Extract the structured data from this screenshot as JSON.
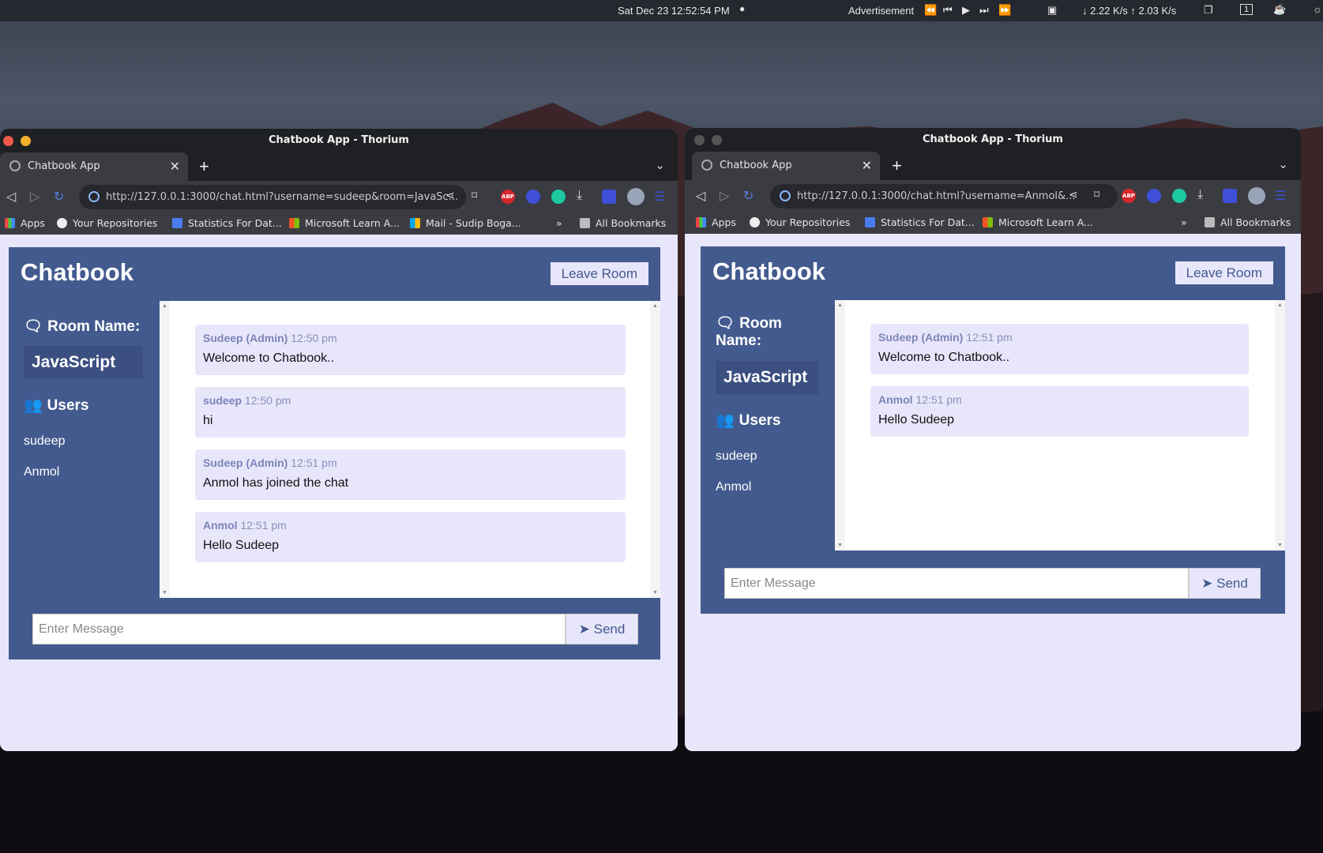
{
  "topbar": {
    "datetime": "Sat Dec 23  12:52:54 PM",
    "advertisement": "Advertisement",
    "netspeed": "↓ 2.22 K/s ↑ 2.03 K/s",
    "workspace": "1"
  },
  "left_window": {
    "title": "Chatbook App - Thorium",
    "tab_label": "Chatbook App",
    "url": "http://127.0.0.1:3000/chat.html?username=sudeep&room=JavaSc...",
    "bookmarks": [
      "Apps",
      "Your Repositories",
      "Statistics For Dat...",
      "Microsoft Learn A...",
      "Mail - Sudip Boga..."
    ],
    "more_bookmarks": "»",
    "all_bookmarks": "All Bookmarks",
    "app": {
      "title": "Chatbook",
      "leave_label": "Leave Room",
      "room_heading": "Room Name:",
      "room_name": "JavaScript",
      "users_heading": "Users",
      "users": [
        "sudeep",
        "Anmol"
      ],
      "messages": [
        {
          "author": "Sudeep (Admin)",
          "time": "12:50 pm",
          "text": "Welcome to Chatbook.."
        },
        {
          "author": "sudeep",
          "time": "12:50 pm",
          "text": "hi"
        },
        {
          "author": "Sudeep (Admin)",
          "time": "12:51 pm",
          "text": "Anmol has joined the chat"
        },
        {
          "author": "Anmol",
          "time": "12:51 pm",
          "text": "Hello Sudeep"
        }
      ],
      "input_placeholder": "Enter Message",
      "send_label": "Send"
    }
  },
  "right_window": {
    "title": "Chatbook App - Thorium",
    "tab_label": "Chatbook App",
    "url": "http://127.0.0.1:3000/chat.html?username=Anmol&...",
    "bookmarks": [
      "Apps",
      "Your Repositories",
      "Statistics For Dat...",
      "Microsoft Learn A..."
    ],
    "more_bookmarks": "»",
    "all_bookmarks": "All Bookmarks",
    "app": {
      "title": "Chatbook",
      "leave_label": "Leave Room",
      "room_heading_1": "Room",
      "room_heading_2": "Name:",
      "room_name": "JavaScript",
      "users_heading": "Users",
      "users": [
        "sudeep",
        "Anmol"
      ],
      "messages": [
        {
          "author": "Sudeep (Admin)",
          "time": "12:51 pm",
          "text": "Welcome to Chatbook.."
        },
        {
          "author": "Anmol",
          "time": "12:51 pm",
          "text": "Hello Sudeep"
        }
      ],
      "input_placeholder": "Enter Message",
      "send_label": "Send"
    }
  },
  "colors": {
    "app_bg": "#435a8e",
    "page_bg": "#e8e6fb",
    "sidebar_room_bg": "#3b4f80"
  }
}
